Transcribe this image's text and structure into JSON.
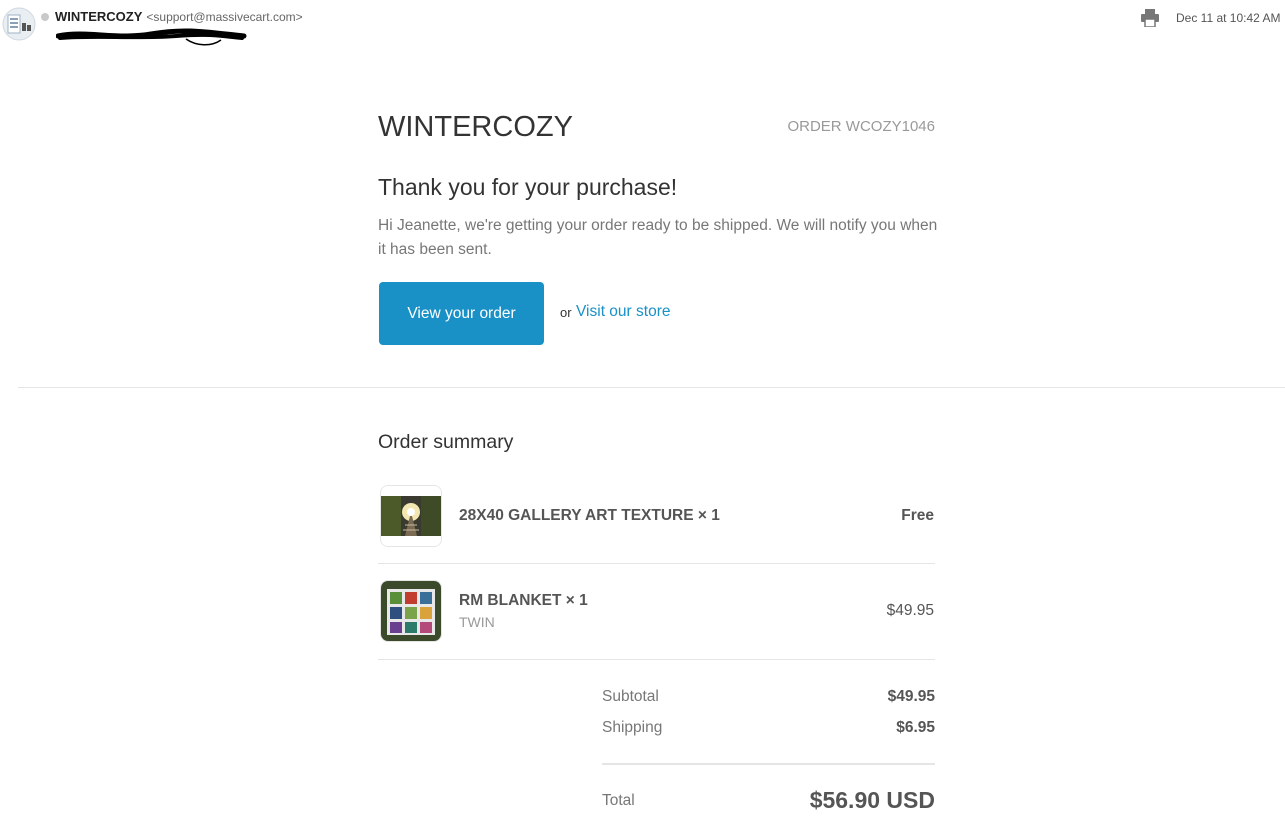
{
  "header": {
    "sender_name": "WINTERCOZY",
    "sender_email": "<support@massivecart.com>",
    "date": "Dec 11 at 10:42 AM",
    "icons": [
      "avatar-icon",
      "print-icon"
    ]
  },
  "email": {
    "shop_name": "WINTERCOZY",
    "order_number": "ORDER WCOZY1046",
    "thanks_heading": "Thank you for your purchase!",
    "intro_text": "Hi Jeanette, we're getting your order ready to be shipped. We will notify you when it has been sent.",
    "view_order_button": "View your order",
    "or_text": "or",
    "visit_store_link": "Visit our store",
    "accent_color": "#1990c6"
  },
  "summary": {
    "title": "Order summary",
    "items": [
      {
        "title": "28X40 GALLERY ART TEXTURE × 1",
        "variant": "",
        "price": "Free"
      },
      {
        "title": "RM BLANKET × 1",
        "variant": "TWIN",
        "price": "$49.95"
      }
    ],
    "subtotal_label": "Subtotal",
    "subtotal_value": "$49.95",
    "shipping_label": "Shipping",
    "shipping_value": "$6.95",
    "total_label": "Total",
    "total_value": "$56.90 USD"
  }
}
